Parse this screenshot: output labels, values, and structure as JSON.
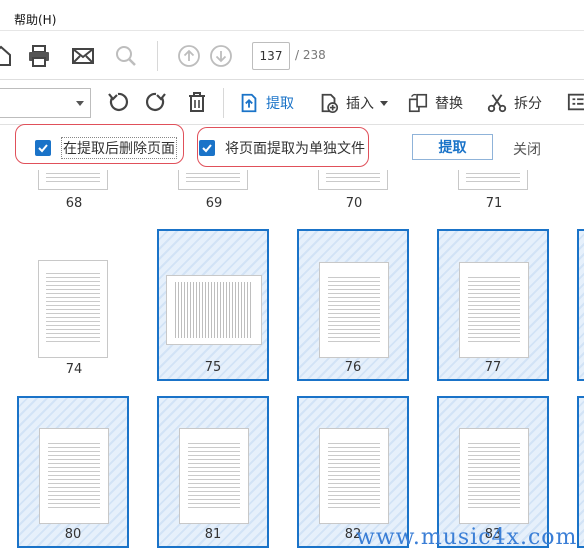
{
  "menu": {
    "help": "帮助(H)"
  },
  "toolbar": {
    "page_current": "137",
    "page_total": "/ 238",
    "icons": [
      "home-icon",
      "print-icon",
      "mail-icon",
      "search-icon",
      "arrow-up-icon",
      "arrow-down-icon"
    ]
  },
  "organize": {
    "extract_label": "提取",
    "insert_label": "插入",
    "replace_label": "替换",
    "split_label": "拆分",
    "accent": "#1a73c8"
  },
  "options": {
    "delete_after_extract": "在提取后删除页面",
    "extract_separate": "将页面提取为单独文件",
    "extract_button": "提取",
    "close_button": "关闭",
    "delete_after_extract_checked": true,
    "extract_separate_checked": true,
    "highlight_color": "#e0505a"
  },
  "thumbnails": {
    "row1": [
      "68",
      "69",
      "70",
      "71"
    ],
    "row2": [
      "74",
      "75",
      "76",
      "77"
    ],
    "row3": [
      "80",
      "81",
      "82",
      "83"
    ],
    "selected": [
      "75",
      "76",
      "77",
      "80",
      "81",
      "82",
      "83"
    ]
  },
  "watermark": "www.music4x.com"
}
